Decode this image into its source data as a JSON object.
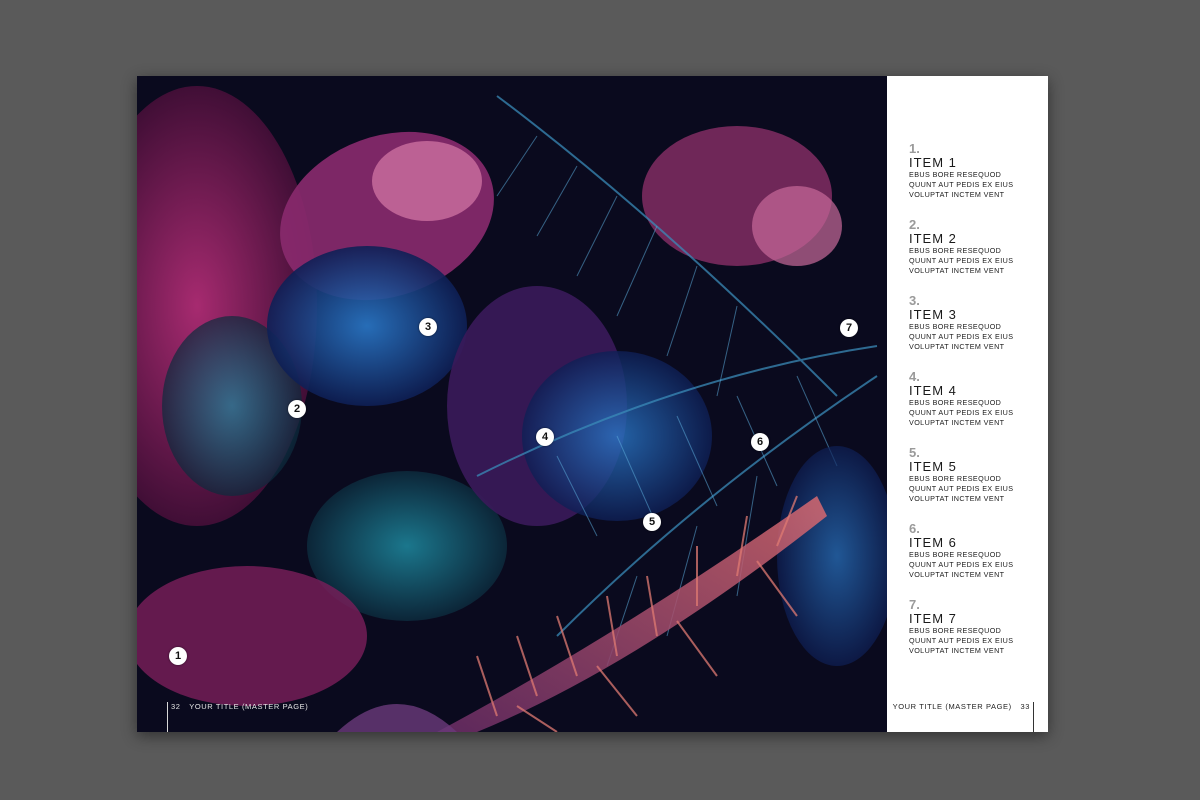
{
  "markers": [
    "1",
    "2",
    "3",
    "4",
    "5",
    "6",
    "7"
  ],
  "left_page": {
    "number": "32",
    "title": "YOUR TITLE (MASTER PAGE)"
  },
  "right_page": {
    "number": "33",
    "title": "YOUR TITLE (MASTER PAGE)"
  },
  "items": [
    {
      "num": "1.",
      "title": "ITEM 1",
      "lines": [
        "EBUS BORE RESEQUOD",
        "QUUNT AUT PEDIS EX EIUS",
        "VOLUPTAT INCTEM VENT"
      ]
    },
    {
      "num": "2.",
      "title": "ITEM 2",
      "lines": [
        "EBUS BORE RESEQUOD",
        "QUUNT AUT PEDIS EX EIUS",
        "VOLUPTAT INCTEM VENT"
      ]
    },
    {
      "num": "3.",
      "title": "ITEM 3",
      "lines": [
        "EBUS BORE RESEQUOD",
        "QUUNT AUT PEDIS EX EIUS",
        "VOLUPTAT INCTEM VENT"
      ]
    },
    {
      "num": "4.",
      "title": "ITEM 4",
      "lines": [
        "EBUS BORE RESEQUOD",
        "QUUNT AUT PEDIS EX EIUS",
        "VOLUPTAT INCTEM VENT"
      ]
    },
    {
      "num": "5.",
      "title": "ITEM 5",
      "lines": [
        "EBUS BORE RESEQUOD",
        "QUUNT AUT PEDIS EX EIUS",
        "VOLUPTAT INCTEM VENT"
      ]
    },
    {
      "num": "6.",
      "title": "ITEM 6",
      "lines": [
        "EBUS BORE RESEQUOD",
        "QUUNT AUT PEDIS EX EIUS",
        "VOLUPTAT INCTEM VENT"
      ]
    },
    {
      "num": "7.",
      "title": "ITEM 7",
      "lines": [
        "EBUS BORE RESEQUOD",
        "QUUNT AUT PEDIS EX EIUS",
        "VOLUPTAT INCTEM VENT"
      ]
    }
  ]
}
